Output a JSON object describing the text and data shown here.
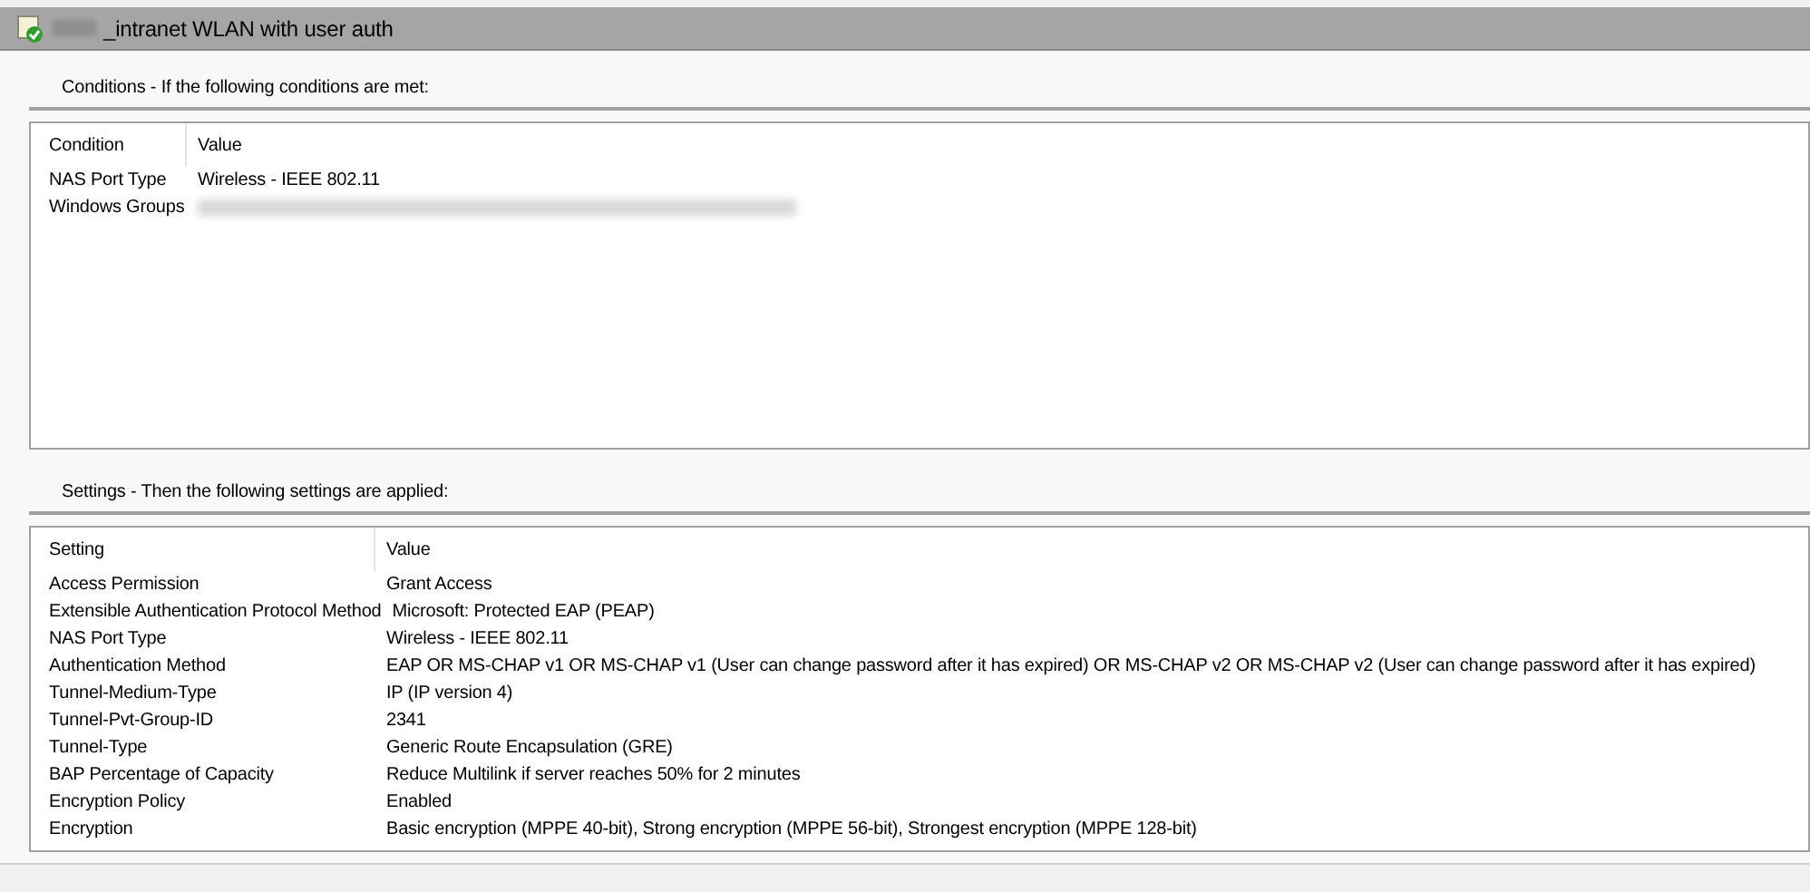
{
  "policy": {
    "title": "_intranet WLAN with user auth"
  },
  "conditions": {
    "heading": "Conditions - If the following conditions are met:",
    "columns": [
      "Condition",
      "Value"
    ],
    "rows": [
      {
        "name": "NAS Port Type",
        "value": "Wireless - IEEE 802.11",
        "redacted": false
      },
      {
        "name": "Windows Groups",
        "redacted": true
      }
    ]
  },
  "settings": {
    "heading": "Settings - Then the following settings are applied:",
    "columns": [
      "Setting",
      "Value"
    ],
    "rows": [
      {
        "name": "Access Permission",
        "value": "Grant Access"
      },
      {
        "name": "Extensible Authentication Protocol Method",
        "value": "Microsoft: Protected EAP (PEAP)"
      },
      {
        "name": "NAS Port Type",
        "value": "Wireless - IEEE 802.11"
      },
      {
        "name": "Authentication Method",
        "value": "EAP OR MS-CHAP v1 OR MS-CHAP v1 (User can change password after it has expired) OR MS-CHAP v2 OR MS-CHAP v2 (User can change password after it has expired)"
      },
      {
        "name": "Tunnel-Medium-Type",
        "value": "IP (IP version 4)"
      },
      {
        "name": "Tunnel-Pvt-Group-ID",
        "value": "2341"
      },
      {
        "name": "Tunnel-Type",
        "value": "Generic Route Encapsulation (GRE)"
      },
      {
        "name": "BAP Percentage of Capacity",
        "value": "Reduce Multilink if server reaches 50% for 2 minutes"
      },
      {
        "name": "Encryption Policy",
        "value": "Enabled"
      },
      {
        "name": "Encryption",
        "value": "Basic encryption (MPPE 40-bit), Strong encryption (MPPE 56-bit), Strongest encryption (MPPE 128-bit)"
      }
    ]
  }
}
